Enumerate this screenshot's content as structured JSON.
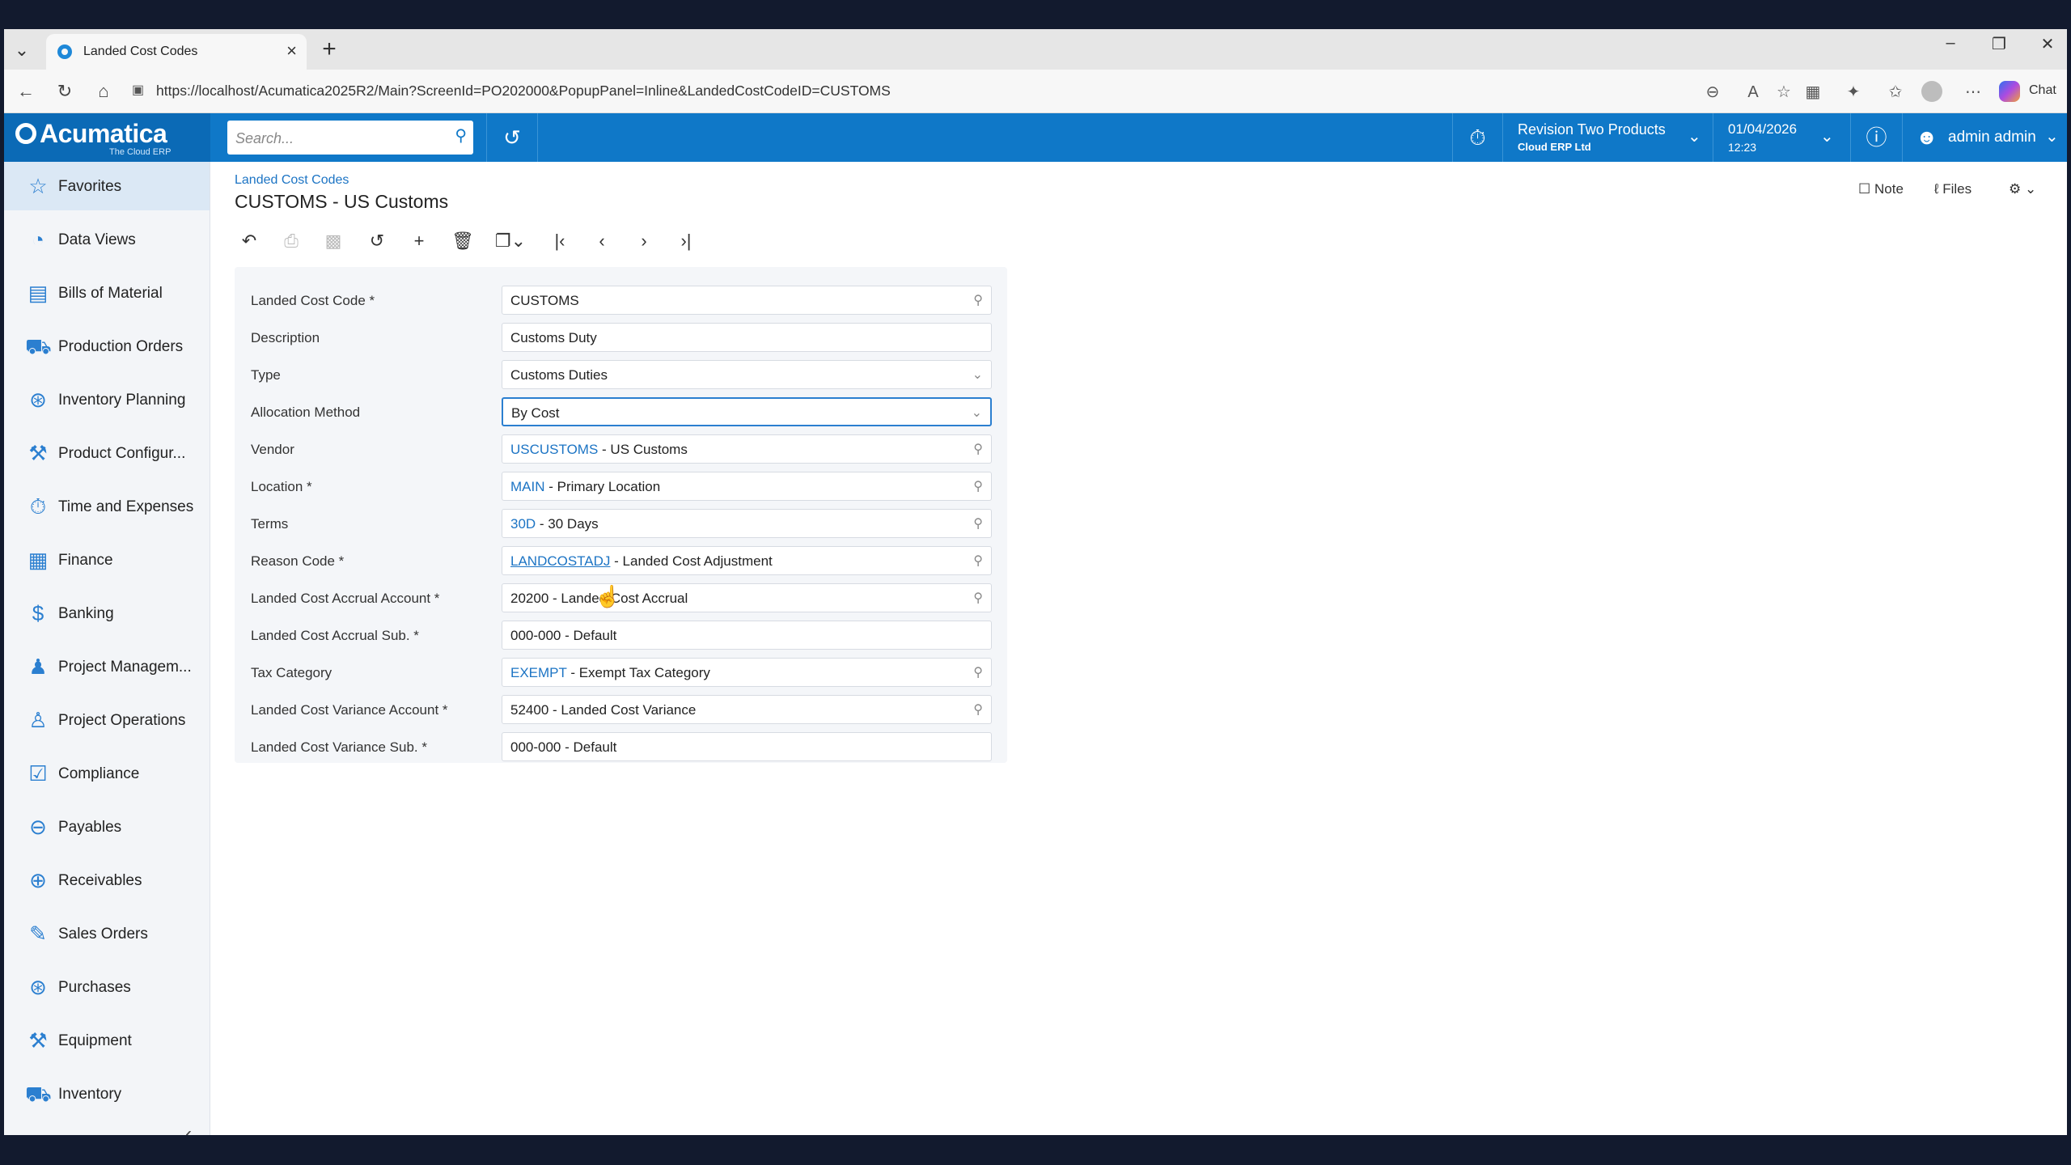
{
  "browser": {
    "tab_title": "Landed Cost Codes",
    "url": "https://localhost/Acumatica2025R2/Main?ScreenId=PO202000&PopupPanel=Inline&LandedCostCodeID=CUSTOMS",
    "chat_label": "Chat"
  },
  "header": {
    "logo_name": "Acumatica",
    "logo_tagline": "The Cloud ERP",
    "search_placeholder": "Search...",
    "company_name": "Revision Two Products",
    "company_sub": "Cloud ERP Ltd",
    "date": "01/04/2026",
    "time": "12:23",
    "user": "admin admin"
  },
  "sidebar": {
    "items": [
      {
        "label": "Favorites",
        "icon": "star-icon"
      },
      {
        "label": "Data Views",
        "icon": "pie-chart-icon"
      },
      {
        "label": "Bills of Material",
        "icon": "document-list-icon"
      },
      {
        "label": "Production Orders",
        "icon": "truck-icon"
      },
      {
        "label": "Inventory Planning",
        "icon": "cart-icon"
      },
      {
        "label": "Product Configur...",
        "icon": "wrench-icon"
      },
      {
        "label": "Time and Expenses",
        "icon": "stopwatch-icon"
      },
      {
        "label": "Finance",
        "icon": "calculator-icon"
      },
      {
        "label": "Banking",
        "icon": "dollar-icon"
      },
      {
        "label": "Project Managem...",
        "icon": "people-icon"
      },
      {
        "label": "Project Operations",
        "icon": "person-icon"
      },
      {
        "label": "Compliance",
        "icon": "checklist-icon"
      },
      {
        "label": "Payables",
        "icon": "minus-circle-icon"
      },
      {
        "label": "Receivables",
        "icon": "plus-circle-icon"
      },
      {
        "label": "Sales Orders",
        "icon": "pencil-icon"
      },
      {
        "label": "Purchases",
        "icon": "cart-icon"
      },
      {
        "label": "Equipment",
        "icon": "wrench-icon"
      },
      {
        "label": "Inventory",
        "icon": "truck-icon"
      }
    ]
  },
  "page": {
    "breadcrumb": "Landed Cost Codes",
    "title": "CUSTOMS - US Customs",
    "note_label": "Note",
    "files_label": "Files"
  },
  "form": {
    "landed_cost_code": {
      "label": "Landed Cost Code *",
      "value": "CUSTOMS"
    },
    "description": {
      "label": "Description",
      "value": "Customs Duty"
    },
    "type": {
      "label": "Type",
      "value": "Customs Duties"
    },
    "allocation_method": {
      "label": "Allocation Method",
      "value": "By Cost"
    },
    "vendor": {
      "label": "Vendor",
      "code": "USCUSTOMS",
      "desc": " - US Customs"
    },
    "location": {
      "label": "Location *",
      "code": "MAIN",
      "desc": " - Primary Location"
    },
    "terms": {
      "label": "Terms",
      "code": "30D",
      "desc": " - 30 Days"
    },
    "reason_code": {
      "label": "Reason Code *",
      "code": "LANDCOSTADJ",
      "desc": " - Landed Cost Adjustment"
    },
    "accrual_account": {
      "label": "Landed Cost Accrual Account *",
      "value": "20200 - Landed Cost Accrual"
    },
    "accrual_sub": {
      "label": "Landed Cost Accrual Sub. *",
      "value": "000-000 - Default"
    },
    "tax_category": {
      "label": "Tax Category",
      "code": "EXEMPT",
      "desc": " - Exempt Tax Category"
    },
    "variance_account": {
      "label": "Landed Cost Variance Account *",
      "value": "52400 - Landed Cost Variance"
    },
    "variance_sub": {
      "label": "Landed Cost Variance Sub. *",
      "value": "000-000 - Default"
    }
  },
  "colors": {
    "header_blue": "#0f78c8",
    "link_blue": "#1c74c4",
    "sidebar_bg": "#f3f5f8"
  }
}
